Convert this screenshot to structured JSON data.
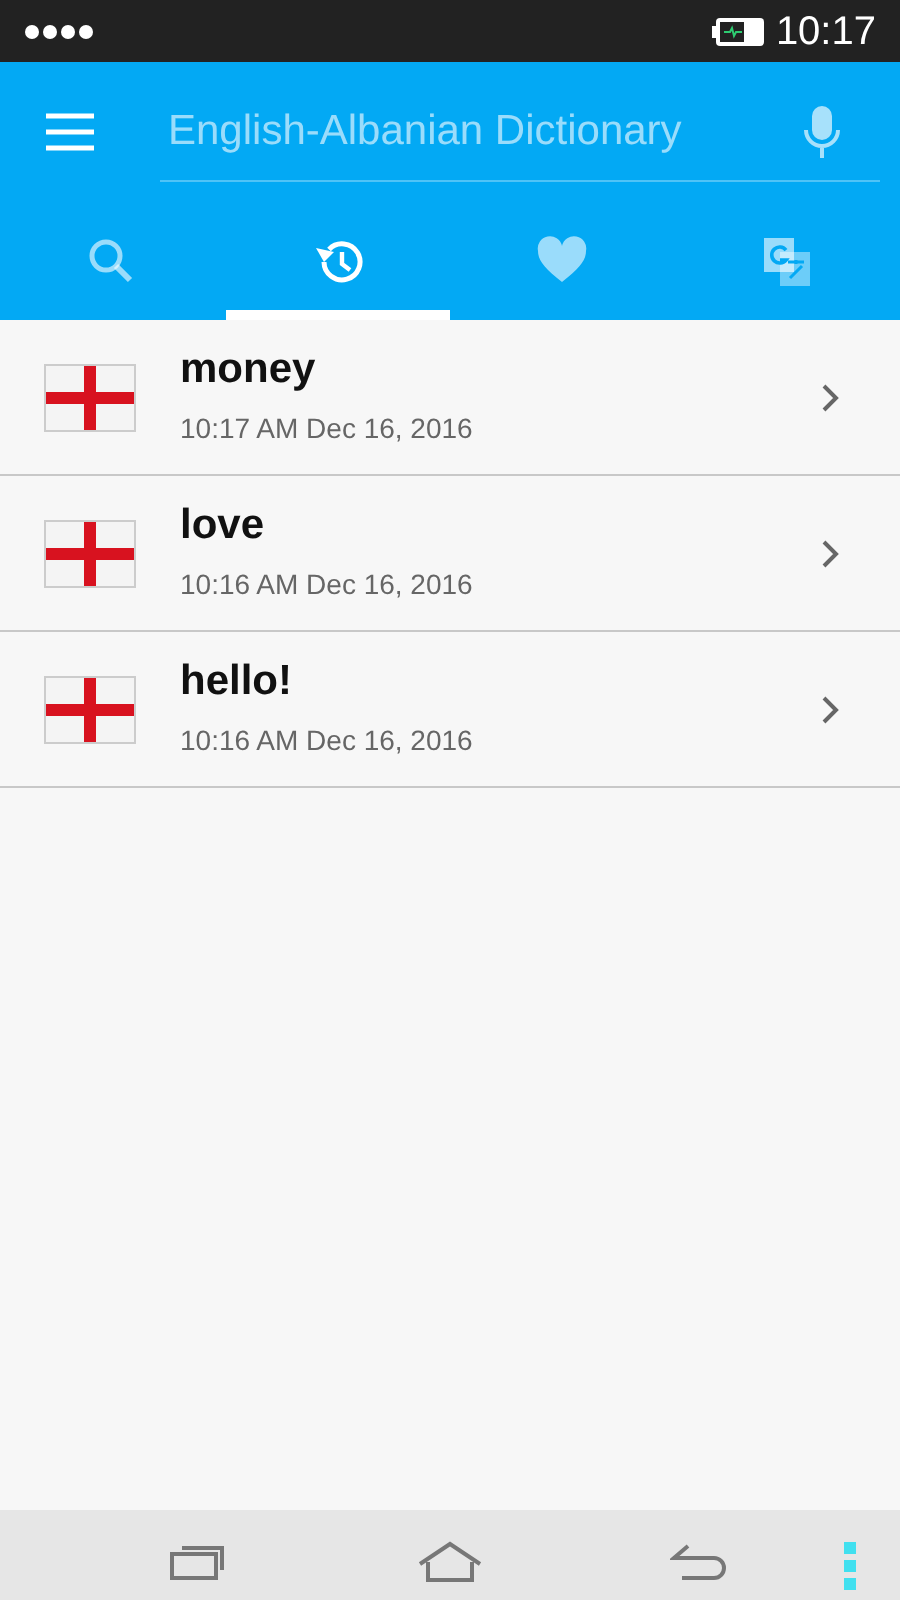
{
  "status_bar": {
    "time": "10:17"
  },
  "search": {
    "placeholder": "English-Albanian Dictionary"
  },
  "tabs": [
    {
      "kind": "search",
      "selected": false
    },
    {
      "kind": "history",
      "selected": true
    },
    {
      "kind": "favorites",
      "selected": false
    },
    {
      "kind": "translate",
      "selected": false
    }
  ],
  "history": [
    {
      "word": "money",
      "timestamp": "10:17 AM Dec 16, 2016"
    },
    {
      "word": "love",
      "timestamp": "10:16 AM Dec 16, 2016"
    },
    {
      "word": "hello!",
      "timestamp": "10:16 AM Dec 16, 2016"
    }
  ]
}
